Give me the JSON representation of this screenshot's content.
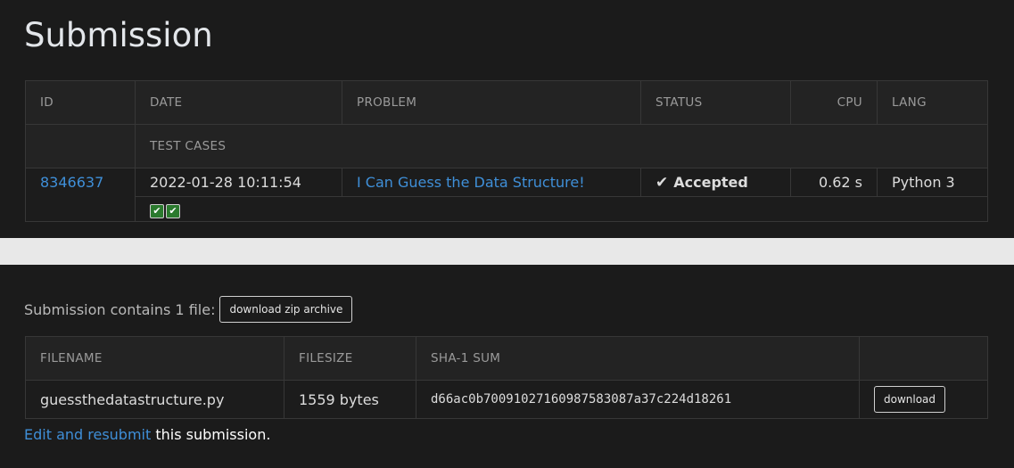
{
  "page": {
    "title": "Submission"
  },
  "submission_table": {
    "headers": {
      "id": "ID",
      "date": "DATE",
      "problem": "PROBLEM",
      "status": "STATUS",
      "cpu": "CPU",
      "lang": "LANG",
      "test_cases": "TEST CASES"
    },
    "row": {
      "id": "8346637",
      "date": "2022-01-28 10:11:54",
      "problem": "I Can Guess the Data Structure!",
      "status": "Accepted",
      "cpu": "0.62 s",
      "lang": "Python 3",
      "test_cases_passed": 2,
      "test_case_icon": "check-icon"
    }
  },
  "files": {
    "summary": "Submission contains 1 file:",
    "download_zip_label": "download zip archive",
    "headers": {
      "filename": "FILENAME",
      "filesize": "FILESIZE",
      "sha1": "SHA-1 SUM"
    },
    "rows": [
      {
        "filename": "guessthedatastructure.py",
        "filesize": "1559 bytes",
        "sha1": "d66ac0b70091027160987583087a37c224d18261",
        "download_label": "download"
      }
    ]
  },
  "resubmit": {
    "link_text": "Edit and resubmit",
    "suffix": " this submission."
  },
  "colors": {
    "accepted": "#2fa43a",
    "link": "#3f8fd8",
    "panel_bg": "#1b1b1b"
  }
}
